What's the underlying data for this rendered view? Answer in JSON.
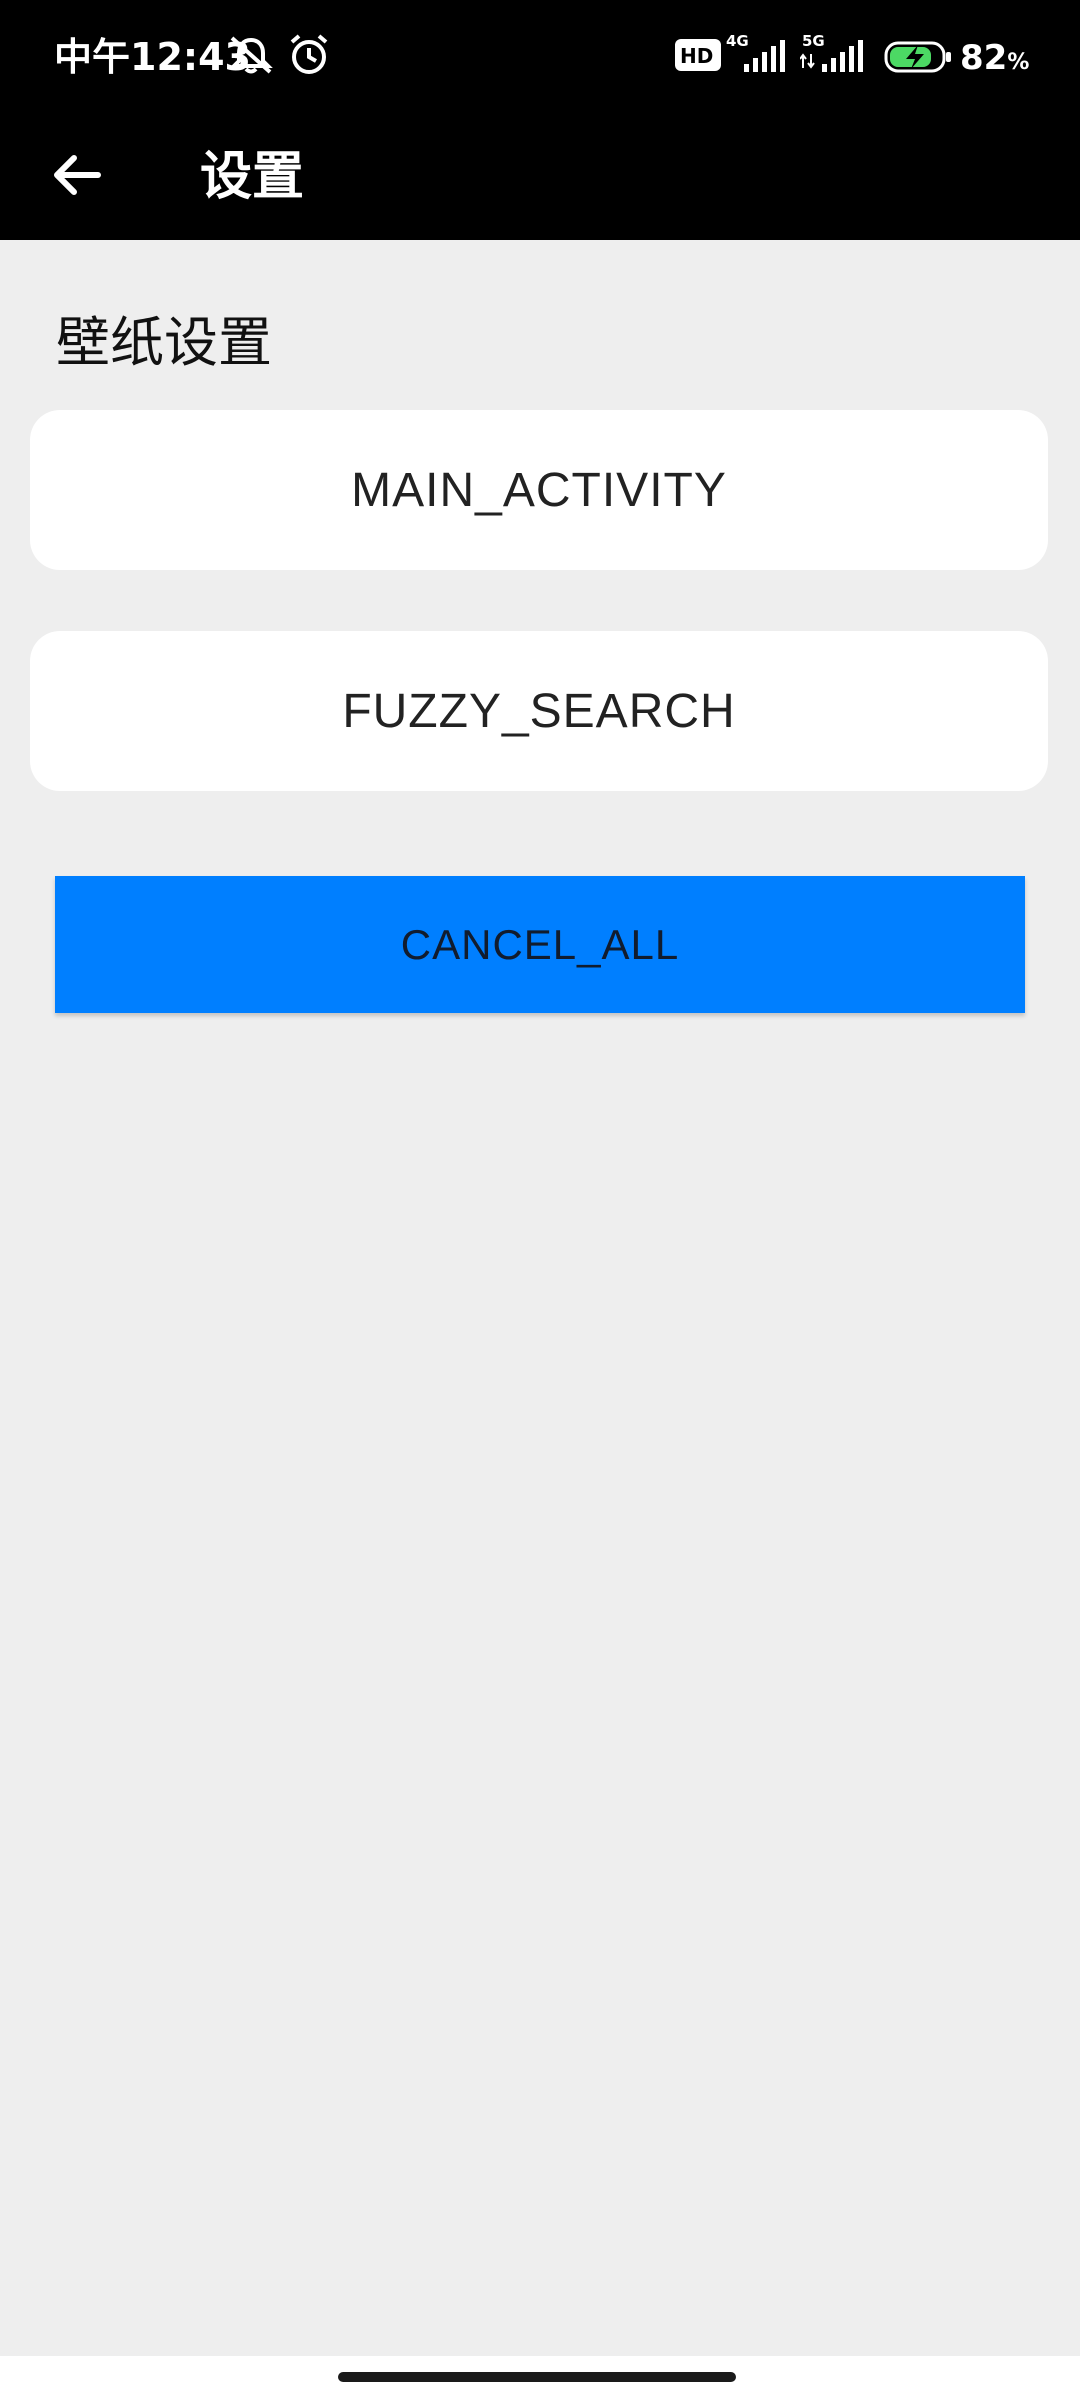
{
  "status_bar": {
    "time": "中午12:43",
    "hd_label": "HD",
    "network_1": "4G",
    "network_2": "5G",
    "battery_percent": "82",
    "percent_sign": "%",
    "battery_level": 0.82,
    "battery_color": "#4cd964",
    "icons": [
      "mute-icon",
      "alarm-icon",
      "hd-icon",
      "signal-4g-icon",
      "signal-5g-icon",
      "battery-charging-icon"
    ]
  },
  "app_bar": {
    "back_icon": "arrow-left-icon",
    "title": "设置"
  },
  "content": {
    "section_title": "壁纸设置",
    "buttons": [
      {
        "label": "MAIN_ACTIVITY"
      },
      {
        "label": "FUZZY_SEARCH"
      }
    ],
    "cancel_button": {
      "label": "CANCEL_ALL",
      "color": "#007fff"
    }
  },
  "colors": {
    "bar_background": "#000000",
    "page_background": "#eeeeee",
    "card_background": "#ffffff",
    "accent": "#007fff"
  }
}
